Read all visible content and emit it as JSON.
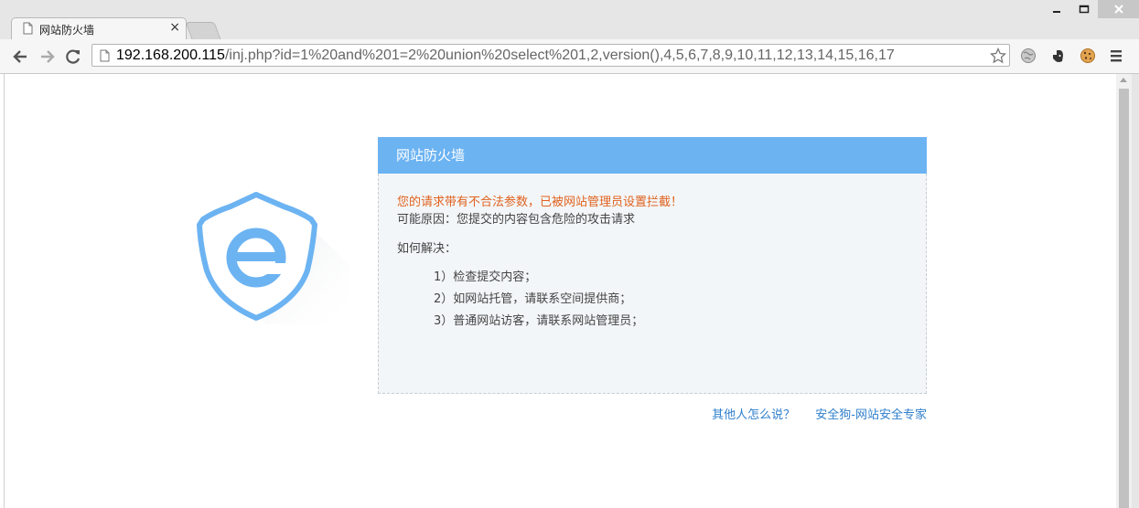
{
  "browser": {
    "tab_title": "网站防火墙",
    "tab_close_glyph": "×",
    "url_host": "192.168.200.115",
    "url_path": "/inj.php?id=1%20and%201=2%20union%20select%201,2,version(),4,5,6,7,8,9,10,11,12,13,14,15,16,17"
  },
  "waf": {
    "title": "网站防火墙",
    "warning": "您的请求带有不合法参数，已被网站管理员设置拦截！",
    "reason": "可能原因：您提交的内容包含危险的攻击请求",
    "howto": "如何解决：",
    "steps": [
      "1）检查提交内容；",
      "2）如网站托管，请联系空间提供商；",
      "3）普通网站访客，请联系网站管理员；"
    ],
    "link_others": "其他人怎么说？",
    "link_brand": "安全狗-网站安全专家",
    "colors": {
      "header": "#6cb3f2",
      "warning": "#e0621f",
      "link": "#2f7fcc",
      "shield": "#6cb3f2"
    }
  }
}
